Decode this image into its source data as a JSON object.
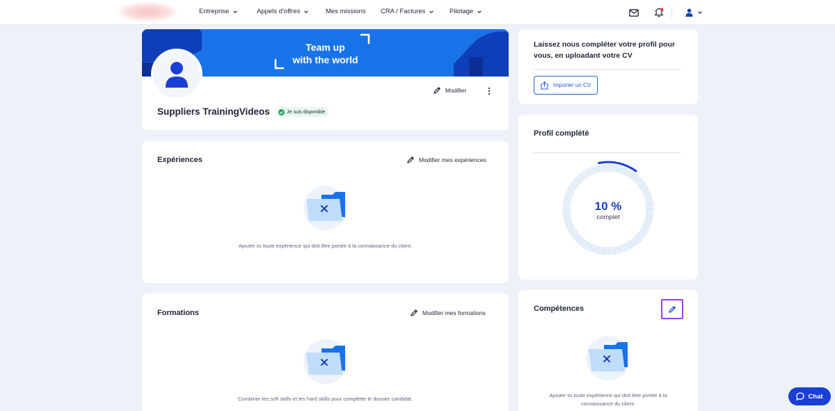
{
  "nav": {
    "items": [
      {
        "label": "Entreprise",
        "has_dropdown": true
      },
      {
        "label": "Appels d'offres",
        "has_dropdown": true
      },
      {
        "label": "Mes missions",
        "has_dropdown": false
      },
      {
        "label": "CRA / Factures",
        "has_dropdown": true
      },
      {
        "label": "Pilotage",
        "has_dropdown": true
      }
    ],
    "icons": [
      "mail-icon",
      "bell-icon",
      "user-icon"
    ]
  },
  "profile": {
    "banner_line1": "Team up",
    "banner_line2": "with the world",
    "name": "Suppliers TrainingVideos",
    "availability": "Je suis disponible",
    "edit_label": "Modifier"
  },
  "experiences": {
    "title": "Expériences",
    "edit_label": "Modifier mes expériences",
    "empty_text": "Ajouter ici toute expérience qui doit être portée à la connaissance du client."
  },
  "formations": {
    "title": "Formations",
    "edit_label": "Modifier mes formations",
    "empty_text": "Combiner les soft skills et les hard skills pour compléter le dossier candidat."
  },
  "cv": {
    "text_line1": "Laissez nous compléter votre profil pour",
    "text_line2": "vous, en uploadant votre CV",
    "button_label": "Importer un CV"
  },
  "completion": {
    "title": "Profil complété",
    "percent_label": "10 %",
    "percent_value": 10,
    "sub_label": "complet"
  },
  "skills": {
    "title": "Compétences",
    "empty_line1": "Ajouter ici toute expérience qui doit être portée à la",
    "empty_line2": "connaissance du client."
  },
  "chat": {
    "label": "Chat"
  },
  "colors": {
    "accent": "#1973e8",
    "primary_dark": "#1a3fd6",
    "success": "#2aa35c",
    "focus": "#9b3ff0"
  }
}
